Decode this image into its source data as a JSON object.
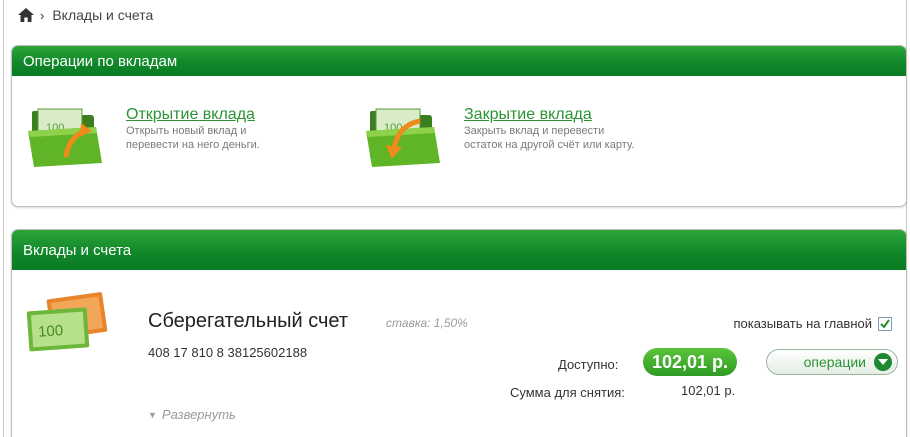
{
  "breadcrumb": {
    "home_icon": "home-icon",
    "separator": "›",
    "current": "Вклады и счета"
  },
  "operations_panel": {
    "title": "Операции по вкладам",
    "open": {
      "icon": "folder-arrow-icon",
      "link": "Открытие вклада",
      "desc_line1": "Открыть новый вклад и",
      "desc_line2": "перевести на него деньги."
    },
    "close": {
      "icon": "folder-arrow-icon",
      "link": "Закрытие вклада",
      "desc_line1": "Закрыть вклад и перевести",
      "desc_line2": "остаток на другой счёт или карту."
    }
  },
  "accounts_panel": {
    "title": "Вклады и счета",
    "account": {
      "icon": "banknotes-icon",
      "name": "Сберегательный счет",
      "rate": "ставка: 1,50%",
      "number": "408 17 810 8 38125602188",
      "show_on_main_label": "показывать на главной",
      "show_on_main_checked": true,
      "available_label": "Доступно:",
      "available_value": "102,01 р.",
      "operations_button": "операции",
      "withdraw_label": "Сумма для снятия:",
      "withdraw_value": "102,01 р.",
      "expand_label": "Развернуть"
    }
  },
  "colors": {
    "header_green": "#11882a",
    "link_green": "#2a9433",
    "badge_green": "#3fae2e"
  }
}
